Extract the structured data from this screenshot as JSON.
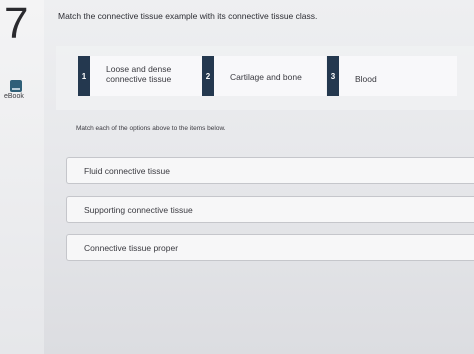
{
  "question": {
    "number": "7",
    "prompt": "Match the connective tissue example with its connective tissue class."
  },
  "sidebar": {
    "ebook_label": "eBook"
  },
  "options": [
    {
      "number": "1",
      "line1": "Loose and dense",
      "line2": "connective tissue"
    },
    {
      "number": "2",
      "line1": "Cartilage and bone",
      "line2": ""
    },
    {
      "number": "3",
      "line1": "Blood",
      "line2": ""
    }
  ],
  "instruction": "Match each of the options above to the items below.",
  "drop_zones": [
    {
      "label": "Fluid connective tissue"
    },
    {
      "label": "Supporting connective tissue"
    },
    {
      "label": "Connective tissue proper"
    }
  ]
}
